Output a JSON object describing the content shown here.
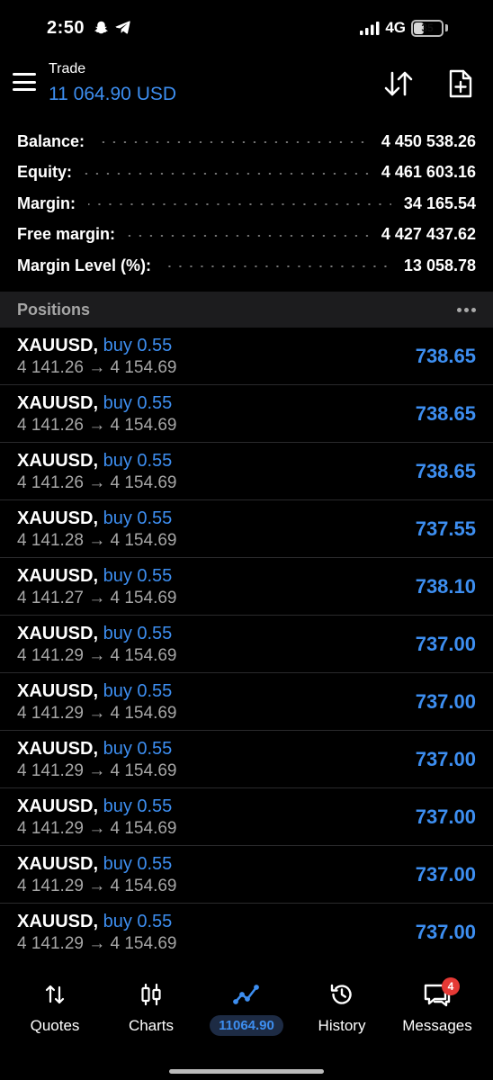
{
  "status_bar": {
    "time": "2:50",
    "network": "4G",
    "battery": "35",
    "battery_level": 0.35
  },
  "header": {
    "title": "Trade",
    "balance": "11 064.90 USD",
    "sort_icon": "sort-arrows-icon",
    "new_order_icon": "new-order-icon"
  },
  "summary": [
    {
      "label": "Balance:",
      "value": "4 450 538.26"
    },
    {
      "label": "Equity:",
      "value": "4 461 603.16"
    },
    {
      "label": "Margin:",
      "value": "34 165.54"
    },
    {
      "label": "Free margin:",
      "value": "4 427 437.62"
    },
    {
      "label": "Margin Level (%):",
      "value": "13 058.78"
    }
  ],
  "positions": {
    "title": "Positions",
    "items": [
      {
        "symbol": "XAUUSD,",
        "side": "buy 0.55",
        "prices": "4 141.26 → 4 154.69",
        "profit": "738.65"
      },
      {
        "symbol": "XAUUSD,",
        "side": "buy 0.55",
        "prices": "4 141.26 → 4 154.69",
        "profit": "738.65"
      },
      {
        "symbol": "XAUUSD,",
        "side": "buy 0.55",
        "prices": "4 141.26 → 4 154.69",
        "profit": "738.65"
      },
      {
        "symbol": "XAUUSD,",
        "side": "buy 0.55",
        "prices": "4 141.28 → 4 154.69",
        "profit": "737.55"
      },
      {
        "symbol": "XAUUSD,",
        "side": "buy 0.55",
        "prices": "4 141.27 → 4 154.69",
        "profit": "738.10"
      },
      {
        "symbol": "XAUUSD,",
        "side": "buy 0.55",
        "prices": "4 141.29 → 4 154.69",
        "profit": "737.00"
      },
      {
        "symbol": "XAUUSD,",
        "side": "buy 0.55",
        "prices": "4 141.29 → 4 154.69",
        "profit": "737.00"
      },
      {
        "symbol": "XAUUSD,",
        "side": "buy 0.55",
        "prices": "4 141.29 → 4 154.69",
        "profit": "737.00"
      },
      {
        "symbol": "XAUUSD,",
        "side": "buy 0.55",
        "prices": "4 141.29 → 4 154.69",
        "profit": "737.00"
      },
      {
        "symbol": "XAUUSD,",
        "side": "buy 0.55",
        "prices": "4 141.29 → 4 154.69",
        "profit": "737.00"
      },
      {
        "symbol": "XAUUSD,",
        "side": "buy 0.55",
        "prices": "4 141.29 → 4 154.69",
        "profit": "737.00"
      }
    ]
  },
  "nav": {
    "quotes": "Quotes",
    "charts": "Charts",
    "trade": "11064.90",
    "history": "History",
    "messages": "Messages",
    "messages_badge": "4"
  },
  "colors": {
    "accent": "#3d8ef0",
    "background": "#000000",
    "section_header": "#1c1c1e",
    "muted_text": "#a6a6a6",
    "badge": "#e53935"
  }
}
